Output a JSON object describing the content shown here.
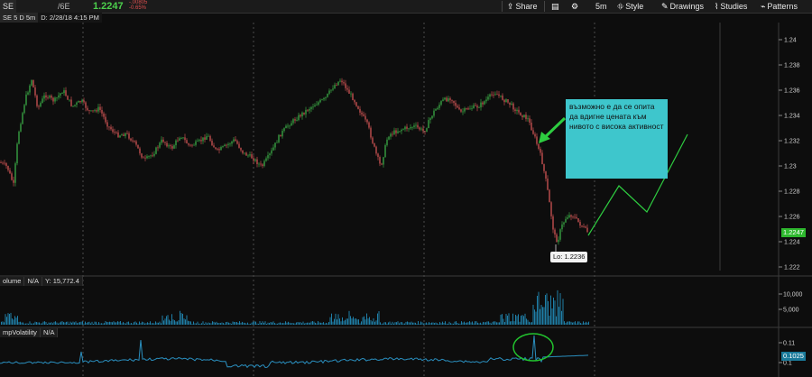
{
  "toolbar": {
    "symbol": "SE",
    "symbol_dropdown": "/6E",
    "last_price": "1.2247",
    "net_change": "-.00805",
    "pct_change": "-0.65%",
    "share_label": "Share",
    "timeframe_label": "5m",
    "style_label": "Style",
    "drawings_label": "Drawings",
    "studies_label": "Studies",
    "patterns_label": "Patterns"
  },
  "chart_header": {
    "aggregation": "SE 5 D 5m",
    "date_label": "D: 2/28/18 4:15 PM"
  },
  "price_axis": {
    "ticks": [
      "1.24",
      "1.238",
      "1.236",
      "1.234",
      "1.232",
      "1.23",
      "1.228",
      "1.226",
      "1.224",
      "1.222"
    ],
    "current_price_tag": "1.2247"
  },
  "annotations": {
    "note_text": "възможно е да се опита да вдигне цената към нивото с висока активност",
    "low_label": "Lo: 1.2236"
  },
  "volume_pane": {
    "title": "olume",
    "value_na": "N/A",
    "y_readout": "Y: 15,772.4",
    "ticks": [
      "10,000",
      "5,000"
    ]
  },
  "volatility_pane": {
    "title": "mpVolatility",
    "value_na": "N/A",
    "tick_upper": "0.11",
    "tick_lower": "0.1",
    "current_tag": "0.1025"
  },
  "colors": {
    "up_candle": "#3fb84a",
    "down_candle": "#e05a5a",
    "volume_bars": "#1f7fa8",
    "note_background": "#3ec6cc",
    "projection_line": "#2ecc40",
    "highlight_ellipse": "#22c22e"
  }
}
